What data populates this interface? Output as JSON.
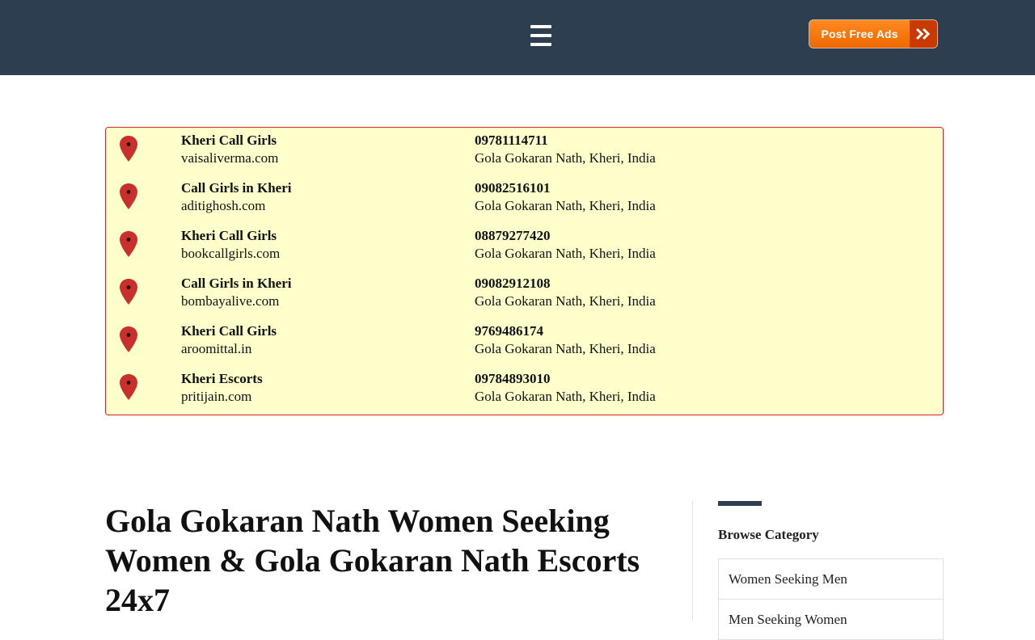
{
  "header": {
    "menu_icon": "hamburger-menu-icon",
    "post_button_label": "Post Free Ads",
    "post_button_icon": "double-chevron-right-icon",
    "background": "#2d3e50",
    "button_color": "#f47a12"
  },
  "listings": [
    {
      "title": "Kheri Call Girls",
      "site": "vaisaliverma.com",
      "phone": "09781114711",
      "location": "Gola Gokaran Nath, Kheri, India"
    },
    {
      "title": "Call Girls in Kheri",
      "site": "aditighosh.com",
      "phone": "09082516101",
      "location": "Gola Gokaran Nath, Kheri, India"
    },
    {
      "title": "Kheri Call Girls",
      "site": "bookcallgirls.com",
      "phone": "08879277420",
      "location": "Gola Gokaran Nath, Kheri, India"
    },
    {
      "title": "Call Girls in Kheri",
      "site": "bombayalive.com",
      "phone": "09082912108",
      "location": "Gola Gokaran Nath, Kheri, India"
    },
    {
      "title": "Kheri Call Girls",
      "site": "aroomittal.in",
      "phone": "9769486174",
      "location": "Gola Gokaran Nath, Kheri, India"
    },
    {
      "title": "Kheri Escorts",
      "site": "pritijain.com",
      "phone": "09784893010",
      "location": "Gola Gokaran Nath, Kheri, India"
    }
  ],
  "listing_icon": "map-pin-icon",
  "listing_colors": {
    "background": "#ffffcc",
    "border": "#d9262b",
    "pin": "#c9302c"
  },
  "main": {
    "title": "Gola Gokaran Nath Women Seeking Women & Gola Gokaran Nath Escorts 24x7"
  },
  "sidebar": {
    "heading": "Browse Category",
    "categories": [
      "Women Seeking Men",
      "Men Seeking Women"
    ]
  }
}
